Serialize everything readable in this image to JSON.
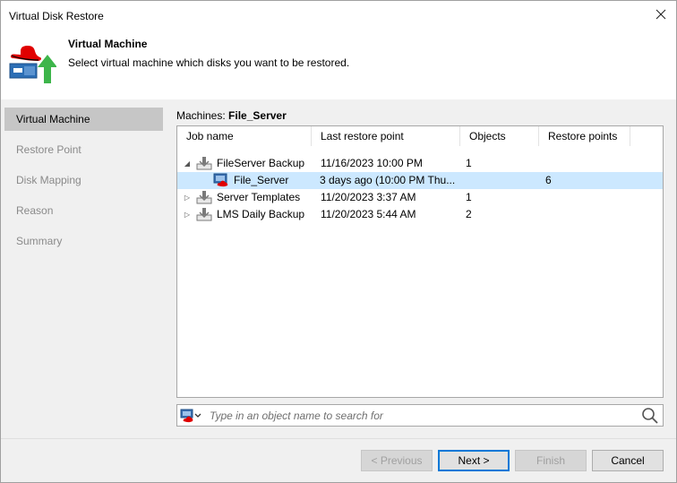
{
  "window": {
    "title": "Virtual Disk Restore"
  },
  "header": {
    "title": "Virtual Machine",
    "description": "Select virtual machine which disks you want to be restored."
  },
  "nav": {
    "items": [
      {
        "label": "Virtual Machine",
        "active": true
      },
      {
        "label": "Restore Point",
        "active": false
      },
      {
        "label": "Disk Mapping",
        "active": false
      },
      {
        "label": "Reason",
        "active": false
      },
      {
        "label": "Summary",
        "active": false
      }
    ]
  },
  "machines": {
    "label": "Machines:",
    "value": "File_Server"
  },
  "tree": {
    "columns": [
      "Job name",
      "Last restore point",
      "Objects",
      "Restore points"
    ],
    "rows": [
      {
        "name": "FileServer Backup",
        "last_restore": "11/16/2023 10:00 PM",
        "objects": "1",
        "restore_points": "",
        "level": 0,
        "expander": "expanded",
        "icon": "backup-job-icon",
        "selected": false
      },
      {
        "name": "File_Server",
        "last_restore": "3 days ago (10:00 PM Thu...",
        "objects": "",
        "restore_points": "6",
        "level": 1,
        "expander": "none",
        "icon": "redhat-vm-icon",
        "selected": true
      },
      {
        "name": "Server Templates",
        "last_restore": "11/20/2023 3:37 AM",
        "objects": "1",
        "restore_points": "",
        "level": 0,
        "expander": "collapsed",
        "icon": "backup-job-icon",
        "selected": false
      },
      {
        "name": "LMS Daily Backup",
        "last_restore": "11/20/2023 5:44 AM",
        "objects": "2",
        "restore_points": "",
        "level": 0,
        "expander": "collapsed",
        "icon": "backup-job-icon",
        "selected": false
      }
    ]
  },
  "search": {
    "placeholder": "Type in an object name to search for",
    "value": ""
  },
  "buttons": {
    "previous": "< Previous",
    "next": "Next >",
    "finish": "Finish",
    "cancel": "Cancel"
  },
  "colors": {
    "selection": "#cce8ff",
    "nav_active": "#c6c6c6",
    "panel_bg": "#f0f0f0",
    "redhat_red": "#e00000",
    "restore_green": "#3db54a",
    "primary_border": "#0078d7"
  }
}
